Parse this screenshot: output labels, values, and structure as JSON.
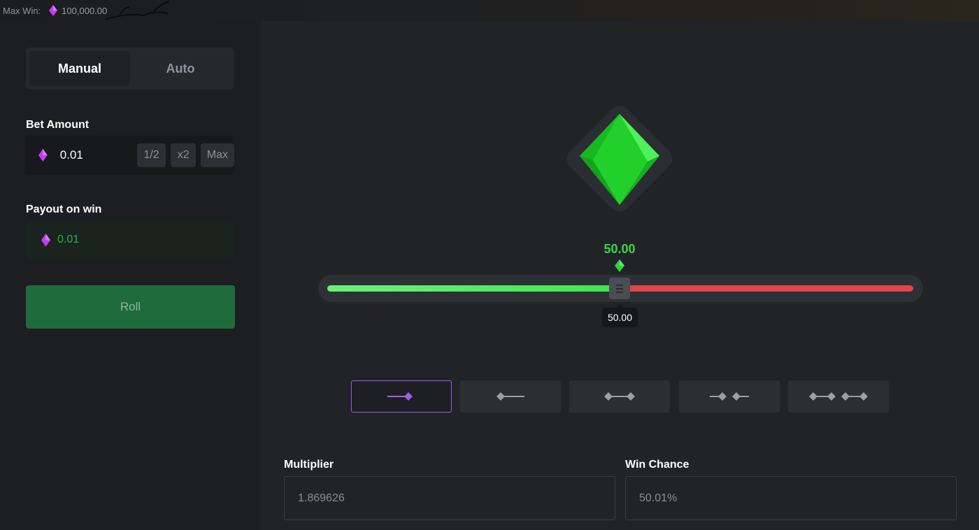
{
  "header": {
    "max_win_label": "Max Win:",
    "max_win_value": "100,000.00"
  },
  "sidebar": {
    "tabs": [
      {
        "label": "Manual",
        "active": true
      },
      {
        "label": "Auto",
        "active": false
      }
    ],
    "bet_amount": {
      "label": "Bet Amount",
      "value": "0.01",
      "buttons": [
        "1/2",
        "x2",
        "Max"
      ]
    },
    "payout": {
      "label": "Payout on win",
      "value": "0.01"
    },
    "roll_label": "Roll"
  },
  "game": {
    "target_value": "50.00",
    "tooltip_value": "50.00",
    "slider_fraction": 0.5,
    "modes": [
      {
        "name": "roll-over",
        "active": true
      },
      {
        "name": "roll-under",
        "active": false
      },
      {
        "name": "roll-between",
        "active": false
      },
      {
        "name": "roll-outside",
        "active": false
      },
      {
        "name": "roll-between-two",
        "active": false
      }
    ]
  },
  "stats": {
    "multiplier_label": "Multiplier",
    "multiplier_value": "1.869626",
    "win_chance_label": "Win Chance",
    "win_chance_value": "50.01%"
  },
  "colors": {
    "gem_purple": "#c23cf5",
    "win_green": "#38d846",
    "lose_red": "#e04545",
    "active_mode_border": "#9b5cf0",
    "roll_button": "#1f6b3b"
  }
}
